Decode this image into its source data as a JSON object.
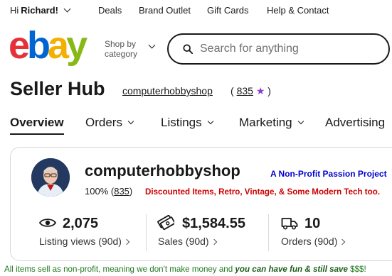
{
  "topbar": {
    "greeting_prefix": "Hi ",
    "greeting_name": "Richard!",
    "links": [
      "Deals",
      "Brand Outlet",
      "Gift Cards",
      "Help & Contact"
    ]
  },
  "header": {
    "logo": {
      "e": "e",
      "b": "b",
      "a": "a",
      "y": "y"
    },
    "shop_by_line1": "Shop by",
    "shop_by_line2": "category",
    "search_placeholder": "Search for anything"
  },
  "title": {
    "heading": "Seller Hub",
    "store_name": "computerhobbyshop",
    "feedback_open": "(",
    "feedback_count": "835",
    "feedback_star": "★",
    "feedback_close": ")"
  },
  "tabs": [
    {
      "label": "Overview",
      "active": true
    },
    {
      "label": "Orders"
    },
    {
      "label": "Listings"
    },
    {
      "label": "Marketing"
    },
    {
      "label": "Advertising"
    }
  ],
  "profile": {
    "shop_name": "computerhobbyshop",
    "tagline": "A Non-Profit Passion Project",
    "positive_pct": "100%",
    "feedback_open": "(",
    "feedback_count": "835",
    "feedback_close": ")",
    "note": "Discounted Items, Retro, Vintage, & Some Modern Tech too."
  },
  "stats": [
    {
      "icon": "eye-icon",
      "value": "2,075",
      "label": "Listing views (90d)"
    },
    {
      "icon": "money-icon",
      "value": "$1,584.55",
      "label": "Sales (90d)"
    },
    {
      "icon": "truck-icon",
      "value": "10",
      "label": "Orders (90d)"
    }
  ],
  "footer": {
    "text": "All items sell as non-profit, meaning we don't make money and ",
    "emphasis": "you can have fun & still save",
    "suffix": " $$$!"
  },
  "colors": {
    "logo_e": "#e53238",
    "logo_b": "#0064d2",
    "logo_a": "#f5af02",
    "logo_y": "#86b817",
    "star": "#8a3cc7",
    "tagline": "#0000cc",
    "note": "#cc0000",
    "footer": "#1f7a1f"
  }
}
